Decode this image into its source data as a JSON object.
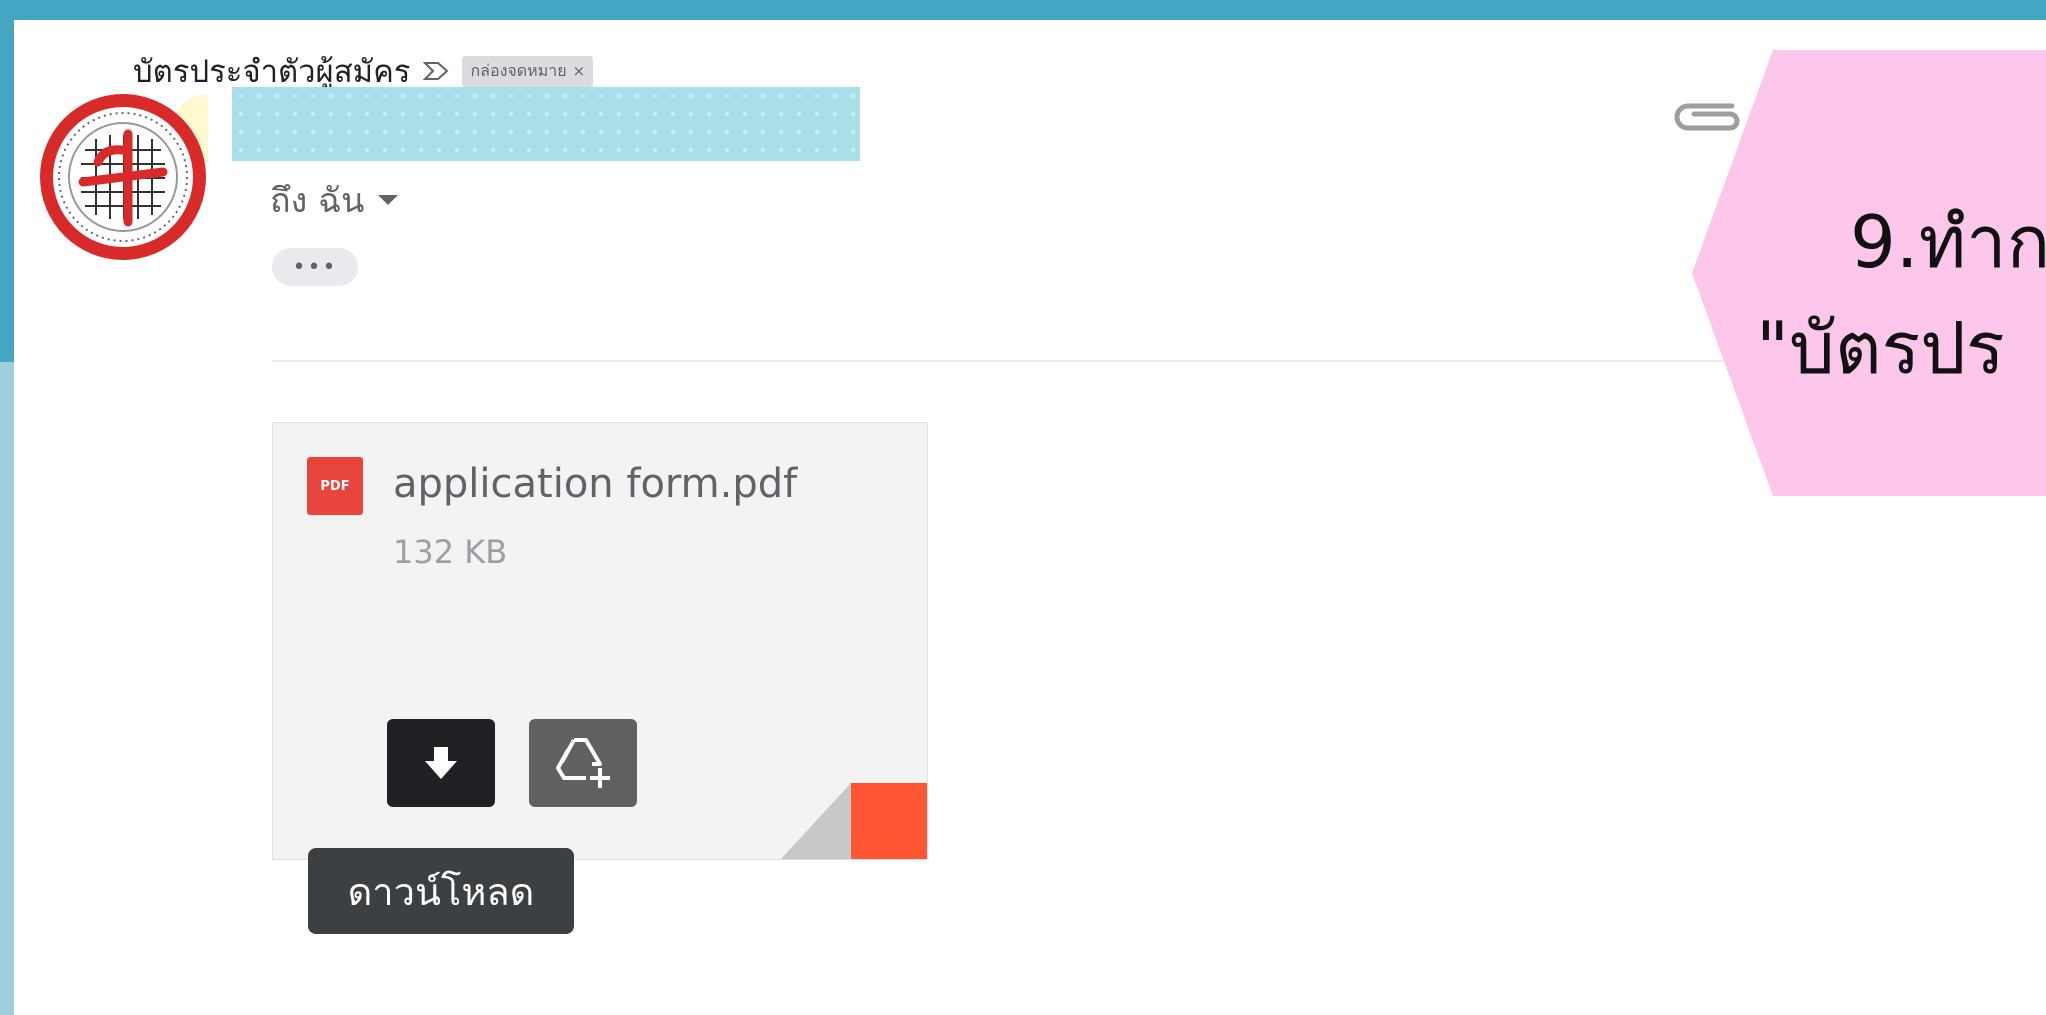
{
  "email": {
    "subject": "บัตรประจำตัวผู้สมัคร",
    "label_chip": "กล่องจดหมาย",
    "label_chip_close": "×",
    "to_me": "ถึง ฉัน",
    "more_dots": "•••"
  },
  "attachment": {
    "type_badge": "PDF",
    "file_name": "application form.pdf",
    "file_size": "132 KB",
    "download_tooltip": "ดาวน์โหลด"
  },
  "callout": {
    "line1": "9.ทำก",
    "line2": "\"บัตรปร"
  },
  "colors": {
    "frame_blue": "#45a6c3",
    "callout_pink": "#fcc7ea",
    "pdf_red": "#e8453c",
    "corner_red": "#ff5533"
  },
  "icons": [
    "label-arrow-icon",
    "chevron-down-icon",
    "paperclip-icon",
    "pdf-file-icon",
    "download-icon",
    "add-to-drive-icon",
    "seal-logo-icon"
  ]
}
